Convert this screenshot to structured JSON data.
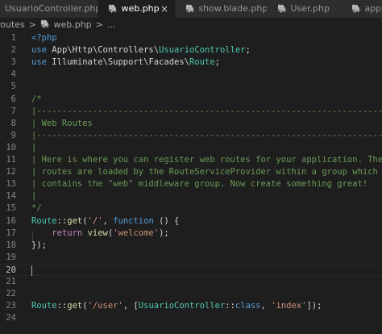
{
  "tabs": [
    {
      "label": "UsuarioController.php",
      "icon": "php-elephant-icon",
      "active": false,
      "closable": false
    },
    {
      "label": "web.php",
      "icon": "php-elephant-icon",
      "active": true,
      "closable": true,
      "close_glyph": "×"
    },
    {
      "label": "show.blade.php",
      "icon": "php-elephant-icon",
      "active": false,
      "closable": false
    },
    {
      "label": "User.php",
      "icon": "php-elephant-icon",
      "active": false,
      "closable": false
    },
    {
      "label": "app",
      "icon": "php-elephant-icon",
      "active": false,
      "closable": false
    }
  ],
  "breadcrumb": {
    "folder": "routes",
    "separator": ">",
    "file": "web.php",
    "file_icon": "php-elephant-icon",
    "symbol": "..."
  },
  "editor": {
    "current_line": 20,
    "lines": [
      {
        "n": "1",
        "tokens": [
          {
            "t": "<?php",
            "c": "tag"
          }
        ]
      },
      {
        "n": "2",
        "tokens": [
          {
            "t": "use ",
            "c": "kw"
          },
          {
            "t": "App",
            "c": "ns"
          },
          {
            "t": "\\",
            "c": "plain"
          },
          {
            "t": "Http",
            "c": "ns"
          },
          {
            "t": "\\",
            "c": "plain"
          },
          {
            "t": "Controllers",
            "c": "ns"
          },
          {
            "t": "\\",
            "c": "plain"
          },
          {
            "t": "UsuarioController",
            "c": "cls"
          },
          {
            "t": ";",
            "c": "plain"
          }
        ]
      },
      {
        "n": "3",
        "tokens": [
          {
            "t": "use ",
            "c": "kw"
          },
          {
            "t": "Illuminate",
            "c": "ns"
          },
          {
            "t": "\\",
            "c": "plain"
          },
          {
            "t": "Support",
            "c": "ns"
          },
          {
            "t": "\\",
            "c": "plain"
          },
          {
            "t": "Facades",
            "c": "ns"
          },
          {
            "t": "\\",
            "c": "plain"
          },
          {
            "t": "Route",
            "c": "cls"
          },
          {
            "t": ";",
            "c": "plain"
          }
        ]
      },
      {
        "n": "4",
        "tokens": []
      },
      {
        "n": "5",
        "tokens": []
      },
      {
        "n": "6",
        "tokens": [
          {
            "t": "/*",
            "c": "cmt"
          }
        ]
      },
      {
        "n": "7",
        "tokens": [
          {
            "t": "|--------------------------------------------------------------------------",
            "c": "cmt"
          }
        ]
      },
      {
        "n": "8",
        "tokens": [
          {
            "t": "| Web Routes",
            "c": "cmt"
          }
        ]
      },
      {
        "n": "9",
        "tokens": [
          {
            "t": "|--------------------------------------------------------------------------",
            "c": "cmt"
          }
        ]
      },
      {
        "n": "10",
        "tokens": [
          {
            "t": "|",
            "c": "cmt"
          }
        ]
      },
      {
        "n": "11",
        "tokens": [
          {
            "t": "| Here is where you can register web routes for your application. These",
            "c": "cmt"
          }
        ]
      },
      {
        "n": "12",
        "tokens": [
          {
            "t": "| routes are loaded by the RouteServiceProvider within a group which",
            "c": "cmt"
          }
        ]
      },
      {
        "n": "13",
        "tokens": [
          {
            "t": "| contains the \"web\" middleware group. Now create something great!",
            "c": "cmt"
          }
        ]
      },
      {
        "n": "14",
        "tokens": [
          {
            "t": "|",
            "c": "cmt"
          }
        ]
      },
      {
        "n": "15",
        "tokens": [
          {
            "t": "*/",
            "c": "cmt"
          }
        ]
      },
      {
        "n": "16",
        "tokens": [
          {
            "t": "Route",
            "c": "cls"
          },
          {
            "t": "::",
            "c": "plain"
          },
          {
            "t": "get",
            "c": "fn"
          },
          {
            "t": "(",
            "c": "plain"
          },
          {
            "t": "'/'",
            "c": "str"
          },
          {
            "t": ", ",
            "c": "plain"
          },
          {
            "t": "function",
            "c": "kw"
          },
          {
            "t": " () {",
            "c": "plain"
          }
        ]
      },
      {
        "n": "17",
        "tokens": [
          {
            "t": "    ",
            "c": "plain"
          },
          {
            "t": "return",
            "c": "ctl"
          },
          {
            "t": " ",
            "c": "plain"
          },
          {
            "t": "view",
            "c": "fn"
          },
          {
            "t": "(",
            "c": "plain"
          },
          {
            "t": "'welcome'",
            "c": "str"
          },
          {
            "t": ");",
            "c": "plain"
          }
        ]
      },
      {
        "n": "18",
        "tokens": [
          {
            "t": "});",
            "c": "plain"
          }
        ]
      },
      {
        "n": "19",
        "tokens": []
      },
      {
        "n": "20",
        "tokens": []
      },
      {
        "n": "21",
        "tokens": []
      },
      {
        "n": "22",
        "tokens": []
      },
      {
        "n": "23",
        "tokens": [
          {
            "t": "Route",
            "c": "cls"
          },
          {
            "t": "::",
            "c": "plain"
          },
          {
            "t": "get",
            "c": "fn"
          },
          {
            "t": "(",
            "c": "plain"
          },
          {
            "t": "'/user'",
            "c": "str"
          },
          {
            "t": ", [",
            "c": "plain"
          },
          {
            "t": "UsuarioController",
            "c": "cls"
          },
          {
            "t": "::",
            "c": "plain"
          },
          {
            "t": "class",
            "c": "kw"
          },
          {
            "t": ", ",
            "c": "plain"
          },
          {
            "t": "'index'",
            "c": "str"
          },
          {
            "t": "]);",
            "c": "plain"
          }
        ]
      },
      {
        "n": "24",
        "tokens": []
      }
    ]
  },
  "colors": {
    "editor_background": "#1e1e1e",
    "tab_active": "#1e1e1e",
    "tab_inactive": "#2d2d2d",
    "php_icon": "#8a7dd8"
  }
}
